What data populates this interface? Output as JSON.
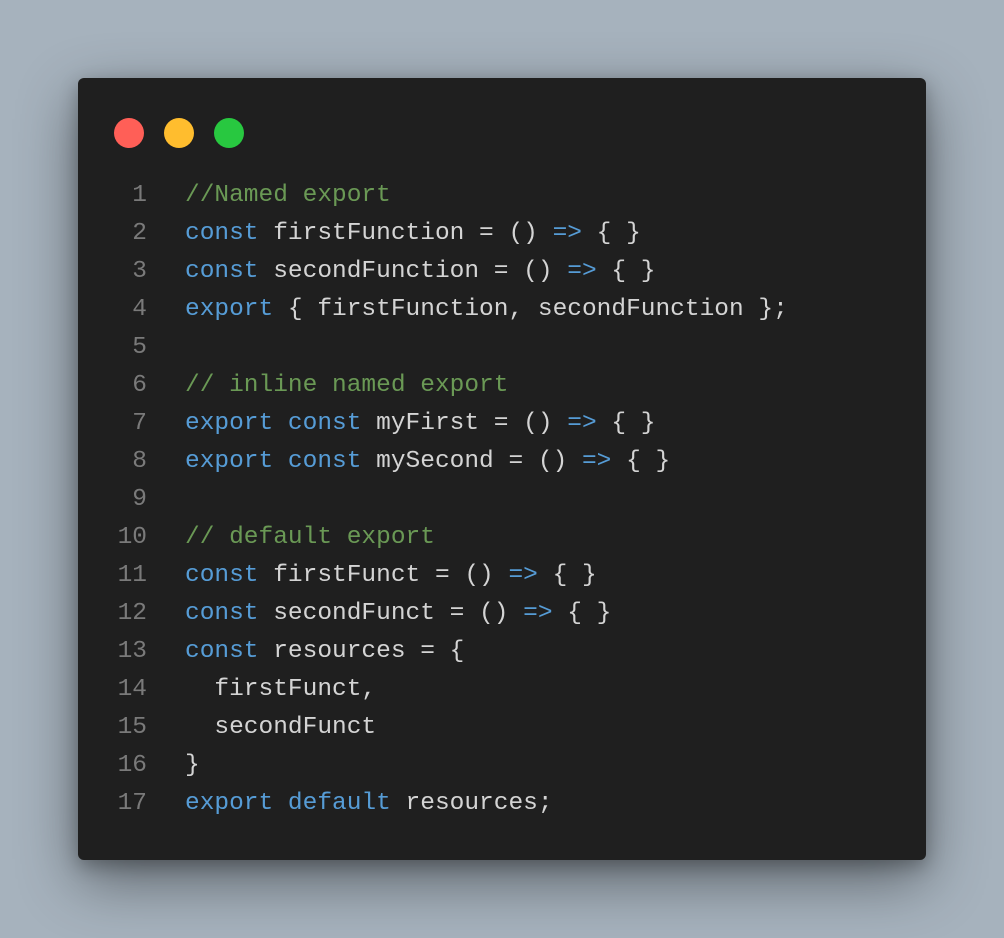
{
  "window": {
    "controls": [
      {
        "name": "close",
        "color": "#ff5f57"
      },
      {
        "name": "minimize",
        "color": "#ffbd2e"
      },
      {
        "name": "maximize",
        "color": "#28c840"
      }
    ]
  },
  "colors": {
    "background": "#a6b2bd",
    "editor": "#1f1f1f",
    "keyword": "#569cd6",
    "comment": "#6a9955",
    "text": "#d4d4d4",
    "line_number": "#7a7a7a"
  },
  "code": {
    "lines": [
      {
        "number": "1",
        "tokens": [
          {
            "t": "//Named export",
            "k": "cm"
          }
        ]
      },
      {
        "number": "2",
        "tokens": [
          {
            "t": "const",
            "k": "kw"
          },
          {
            "t": " firstFunction = () ",
            "k": "id"
          },
          {
            "t": "=>",
            "k": "op"
          },
          {
            "t": " { }",
            "k": "pu"
          }
        ]
      },
      {
        "number": "3",
        "tokens": [
          {
            "t": "const",
            "k": "kw"
          },
          {
            "t": " secondFunction = () ",
            "k": "id"
          },
          {
            "t": "=>",
            "k": "op"
          },
          {
            "t": " { }",
            "k": "pu"
          }
        ]
      },
      {
        "number": "4",
        "tokens": [
          {
            "t": "export",
            "k": "kw"
          },
          {
            "t": " { firstFunction, secondFunction };",
            "k": "id"
          }
        ]
      },
      {
        "number": "5",
        "tokens": []
      },
      {
        "number": "6",
        "tokens": [
          {
            "t": "// inline named export",
            "k": "cm"
          }
        ]
      },
      {
        "number": "7",
        "tokens": [
          {
            "t": "export",
            "k": "kw"
          },
          {
            "t": " ",
            "k": "id"
          },
          {
            "t": "const",
            "k": "kw"
          },
          {
            "t": " myFirst = () ",
            "k": "id"
          },
          {
            "t": "=>",
            "k": "op"
          },
          {
            "t": " { }",
            "k": "pu"
          }
        ]
      },
      {
        "number": "8",
        "tokens": [
          {
            "t": "export",
            "k": "kw"
          },
          {
            "t": " ",
            "k": "id"
          },
          {
            "t": "const",
            "k": "kw"
          },
          {
            "t": " mySecond = () ",
            "k": "id"
          },
          {
            "t": "=>",
            "k": "op"
          },
          {
            "t": " { }",
            "k": "pu"
          }
        ]
      },
      {
        "number": "9",
        "tokens": []
      },
      {
        "number": "10",
        "tokens": [
          {
            "t": "// default export",
            "k": "cm"
          }
        ]
      },
      {
        "number": "11",
        "tokens": [
          {
            "t": "const",
            "k": "kw"
          },
          {
            "t": " firstFunct = () ",
            "k": "id"
          },
          {
            "t": "=>",
            "k": "op"
          },
          {
            "t": " { }",
            "k": "pu"
          }
        ]
      },
      {
        "number": "12",
        "tokens": [
          {
            "t": "const",
            "k": "kw"
          },
          {
            "t": " secondFunct = () ",
            "k": "id"
          },
          {
            "t": "=>",
            "k": "op"
          },
          {
            "t": " { }",
            "k": "pu"
          }
        ]
      },
      {
        "number": "13",
        "tokens": [
          {
            "t": "const",
            "k": "kw"
          },
          {
            "t": " resources = {",
            "k": "id"
          }
        ]
      },
      {
        "number": "14",
        "tokens": [
          {
            "t": "  firstFunct,",
            "k": "id"
          }
        ]
      },
      {
        "number": "15",
        "tokens": [
          {
            "t": "  secondFunct",
            "k": "id"
          }
        ]
      },
      {
        "number": "16",
        "tokens": [
          {
            "t": "}",
            "k": "pu"
          }
        ]
      },
      {
        "number": "17",
        "tokens": [
          {
            "t": "export",
            "k": "kw"
          },
          {
            "t": " ",
            "k": "id"
          },
          {
            "t": "default",
            "k": "kw"
          },
          {
            "t": " resources;",
            "k": "id"
          }
        ]
      }
    ]
  }
}
